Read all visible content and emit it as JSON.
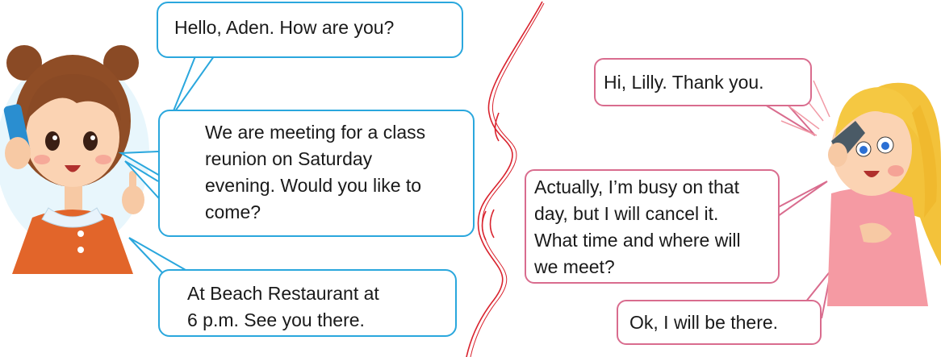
{
  "left_speaker": {
    "bubble_1": [
      "Hello, Aden. How are you?"
    ],
    "bubble_2": [
      "We are meeting for a class",
      "reunion on Saturday",
      "evening. Would you like to",
      "come?"
    ],
    "bubble_3": [
      "At Beach Restaurant at",
      "6 p.m. See you there."
    ]
  },
  "right_speaker": {
    "bubble_1": [
      "Hi, Lilly. Thank you."
    ],
    "bubble_2": [
      "Actually, I’m busy on that",
      "day, but I will cancel it.",
      "What time and where will",
      "we meet?"
    ],
    "bubble_3": [
      "Ok, I will be there."
    ]
  },
  "colors": {
    "left_bubble_border": "#2aa7dd",
    "right_bubble_border": "#d96c8e",
    "divider": "#d9232e"
  },
  "icons": {
    "left_character": "girl-with-phone-illustration",
    "right_character": "blonde-girl-with-phone-illustration",
    "divider": "torn-paper-divider"
  }
}
